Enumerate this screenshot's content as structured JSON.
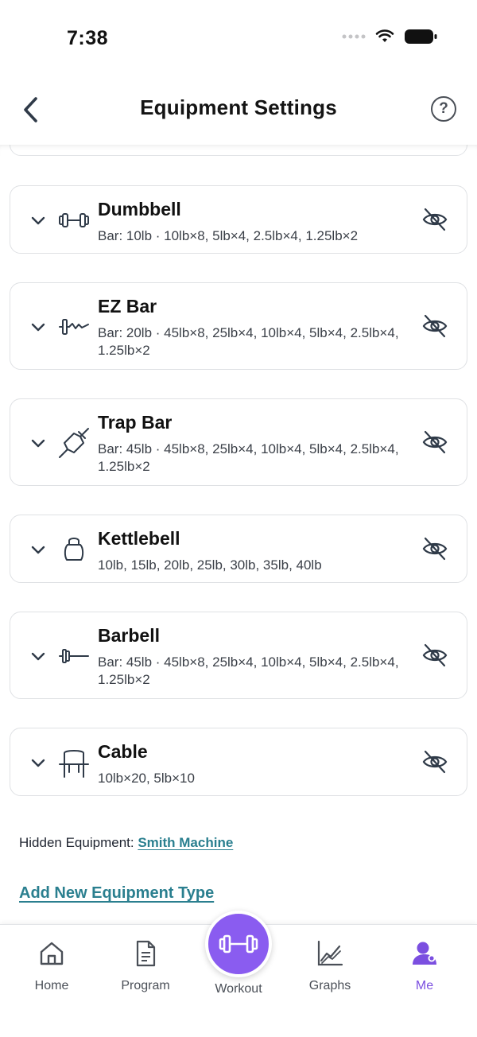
{
  "status_bar": {
    "time": "7:38"
  },
  "header": {
    "title": "Equipment Settings",
    "help_label": "?"
  },
  "equipment": [
    {
      "name": "Dumbbell",
      "detail": "Bar: 10lb · 10lb×8, 5lb×4, 2.5lb×4, 1.25lb×2",
      "icon": "dumbbell-icon"
    },
    {
      "name": "EZ Bar",
      "detail": "Bar: 20lb · 45lb×8, 25lb×4, 10lb×4, 5lb×4, 2.5lb×4, 1.25lb×2",
      "icon": "ez-bar-icon"
    },
    {
      "name": "Trap Bar",
      "detail": "Bar: 45lb · 45lb×8, 25lb×4, 10lb×4, 5lb×4, 2.5lb×4, 1.25lb×2",
      "icon": "trap-bar-icon"
    },
    {
      "name": "Kettlebell",
      "detail": "10lb, 15lb, 20lb, 25lb, 30lb, 35lb, 40lb",
      "icon": "kettlebell-icon"
    },
    {
      "name": "Barbell",
      "detail": "Bar: 45lb · 45lb×8, 25lb×4, 10lb×4, 5lb×4, 2.5lb×4, 1.25lb×2",
      "icon": "barbell-icon"
    },
    {
      "name": "Cable",
      "detail": "10lb×20, 5lb×10",
      "icon": "cable-icon"
    }
  ],
  "hidden": {
    "label": "Hidden Equipment: ",
    "items": [
      "Smith Machine"
    ]
  },
  "add_link": "Add New Equipment Type",
  "tabs": [
    {
      "label": "Home",
      "icon": "home-icon",
      "active": false
    },
    {
      "label": "Program",
      "icon": "document-icon",
      "active": false
    },
    {
      "label": "Workout",
      "icon": "dumbbell-icon",
      "active": false
    },
    {
      "label": "Graphs",
      "icon": "chart-icon",
      "active": false
    },
    {
      "label": "Me",
      "icon": "profile-icon",
      "active": true
    }
  ],
  "colors": {
    "accent": "#8a5cf0",
    "link": "#2a7f8f",
    "active_tab": "#7b4fe0"
  }
}
